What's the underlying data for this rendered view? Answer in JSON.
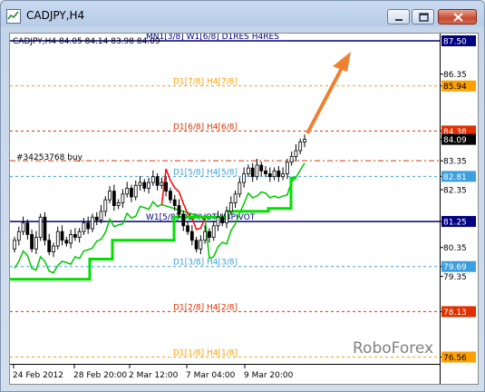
{
  "window": {
    "title": "CADJPY,H4",
    "minimize_label": "minimize",
    "maximize_label": "maximize",
    "close_label": "close"
  },
  "chart_data": {
    "type": "candlestick",
    "symbol": "CADJPY",
    "timeframe": "H4",
    "info_line": "CADJPY,H4  84.05 84.14 83.98 84.09",
    "ohlc": {
      "open": 84.05,
      "high": 84.14,
      "low": 83.98,
      "close": 84.09
    },
    "y_ticks": [
      86.35,
      85.94,
      84.38,
      84.09,
      83.35,
      82.81,
      82.35,
      81.25,
      80.35,
      79.69,
      79.35,
      78.13,
      76.56
    ],
    "x_ticks": [
      "24 Feb 2012",
      "28 Feb 20:00",
      "2 Mar 12:00",
      "7 Mar 04:00",
      "9 Mar 20:00"
    ],
    "grid": false,
    "levels": [
      {
        "label": "MN1[3/8] W1[6/8] D1RES H4RES",
        "value": 87.5,
        "price_tag": "87.50",
        "color": "#000080",
        "style": "solid"
      },
      {
        "label": "D1[7/8] H4[7/8]",
        "value": 85.94,
        "price_tag": "85.94",
        "color": "#ffa000",
        "style": "dashed"
      },
      {
        "label": "D1[6/8] H4[6/8]",
        "value": 84.38,
        "price_tag": "84.38",
        "color": "#e03000",
        "style": "dashed"
      },
      {
        "label": "D1[5/8] H4[5/8]",
        "value": 82.81,
        "price_tag": "82.81",
        "color": "#3ca0e0",
        "style": "dashed"
      },
      {
        "label": "W1[5/8] D1PIVOT H4PIVOT",
        "value": 81.25,
        "price_tag": "81.25",
        "color": "#000080",
        "style": "solid"
      },
      {
        "label": "D1[3/8] H4[3/8]",
        "value": 79.69,
        "price_tag": "79.69",
        "color": "#3ca0e0",
        "style": "dashed"
      },
      {
        "label": "D1[2/8] H4[2/8]",
        "value": 78.13,
        "price_tag": "78.13",
        "color": "#e03000",
        "style": "dashed"
      },
      {
        "label": "D1[1/8] H4[1/8]",
        "value": 76.56,
        "price_tag": "76.56",
        "color": "#ffa000",
        "style": "dashed"
      }
    ],
    "current_price_tag": "84.09",
    "order_line": {
      "label": "#34253768 buy",
      "value": 83.35,
      "color": "#e03000"
    },
    "series": [
      {
        "name": "price",
        "color": "#000000",
        "close": [
          80.6,
          80.9,
          81.2,
          80.8,
          80.3,
          80.7,
          81.4,
          80.6,
          80.2,
          80.4,
          80.9,
          80.6,
          80.5,
          80.8,
          80.7,
          80.9,
          81.2,
          81.0,
          81.4,
          81.3,
          81.6,
          82.0,
          82.3,
          81.8,
          81.9,
          82.2,
          82.4,
          82.1,
          82.5,
          82.6,
          82.4,
          82.6,
          82.8,
          82.5,
          82.6,
          82.3,
          82.0,
          81.8,
          81.5,
          81.1,
          80.9,
          80.6,
          80.3,
          80.6,
          80.9,
          80.7,
          81.1,
          81.4,
          81.2,
          81.6,
          81.9,
          82.2,
          82.6,
          82.9,
          83.1,
          82.8,
          83.2,
          83.0,
          82.9,
          82.8,
          83.0,
          82.8,
          82.9,
          83.3,
          83.5,
          83.7,
          84.0,
          84.09
        ]
      }
    ],
    "overlays": [
      {
        "name": "stop-line-green",
        "color": "#00c800"
      },
      {
        "name": "stop-line-red",
        "color": "#ff0000"
      },
      {
        "name": "trailing-step-green",
        "color": "#00e000"
      }
    ],
    "annotations": [
      {
        "type": "arrow",
        "direction": "up-right",
        "color": "#f08030"
      }
    ],
    "watermark": "RoboForex"
  }
}
